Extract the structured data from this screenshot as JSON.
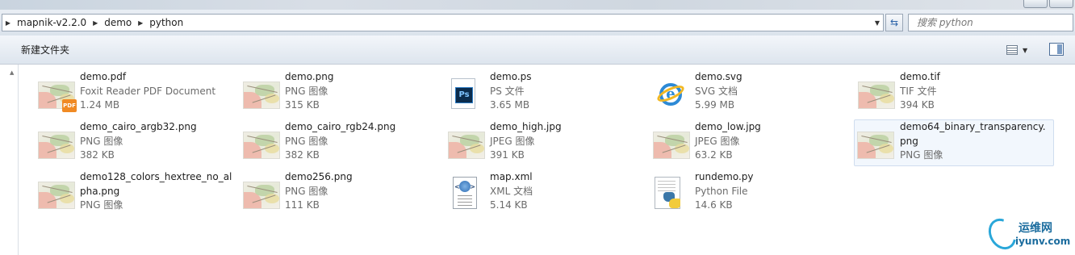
{
  "breadcrumb": {
    "parts": [
      "mapnik-v2.2.0",
      "demo",
      "python"
    ]
  },
  "search": {
    "placeholder": "搜索 python"
  },
  "toolbar": {
    "new_folder": "新建文件夹"
  },
  "files": [
    {
      "name": "demo.pdf",
      "type": "Foxit Reader PDF Document",
      "size": "1.24 MB",
      "icon": "pdf-map-icon"
    },
    {
      "name": "demo.png",
      "type": "PNG 图像",
      "size": "315 KB",
      "icon": "map-thumbnail-icon"
    },
    {
      "name": "demo.ps",
      "type": "PS 文件",
      "size": "3.65 MB",
      "icon": "photoshop-icon"
    },
    {
      "name": "demo.svg",
      "type": "SVG 文档",
      "size": "5.99 MB",
      "icon": "internet-explorer-icon"
    },
    {
      "name": "demo.tif",
      "type": "TIF 文件",
      "size": "394 KB",
      "icon": "map-thumbnail-icon"
    },
    {
      "name": "demo_cairo_argb32.png",
      "type": "PNG 图像",
      "size": "382 KB",
      "icon": "map-thumbnail-icon"
    },
    {
      "name": "demo_cairo_rgb24.png",
      "type": "PNG 图像",
      "size": "382 KB",
      "icon": "map-thumbnail-icon"
    },
    {
      "name": "demo_high.jpg",
      "type": "JPEG 图像",
      "size": "391 KB",
      "icon": "map-thumbnail-icon"
    },
    {
      "name": "demo_low.jpg",
      "type": "JPEG 图像",
      "size": "63.2 KB",
      "icon": "map-thumbnail-icon"
    },
    {
      "name": "demo64_binary_transparency.png",
      "type": "PNG 图像",
      "size": "",
      "icon": "map-thumbnail-icon"
    },
    {
      "name": "demo128_colors_hextree_no_alpha.png",
      "type": "PNG 图像",
      "size": "",
      "icon": "map-thumbnail-icon"
    },
    {
      "name": "demo256.png",
      "type": "PNG 图像",
      "size": "111 KB",
      "icon": "map-thumbnail-icon"
    },
    {
      "name": "map.xml",
      "type": "XML 文档",
      "size": "5.14 KB",
      "icon": "xml-document-icon"
    },
    {
      "name": "rundemo.py",
      "type": "Python File",
      "size": "14.6 KB",
      "icon": "python-file-icon"
    }
  ],
  "watermark": {
    "title": "运维网",
    "url": "iyunv.com"
  },
  "colors": {
    "accent": "#2b63a8",
    "selection_bg": "#f2f7fd",
    "toolbar_bg": "#dde5ee"
  }
}
